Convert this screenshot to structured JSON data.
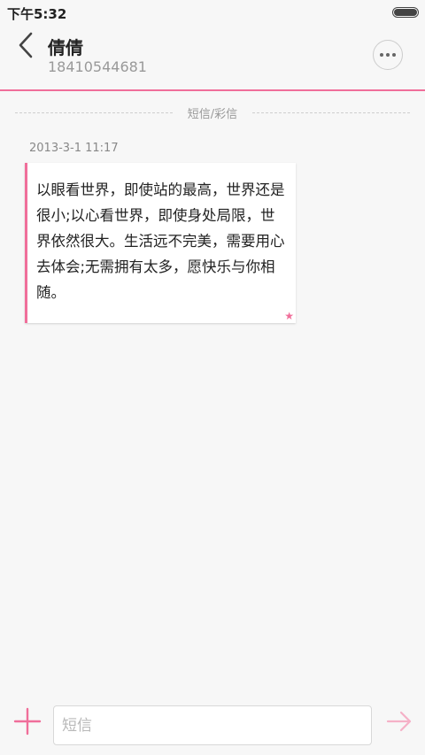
{
  "status_bar": {
    "time": "下午5:32",
    "battery_level": 1.0
  },
  "header": {
    "contact_name": "倩倩",
    "contact_number": "18410544681",
    "back_icon": "chevron-left-icon",
    "more_icon": "more-horizontal-icon"
  },
  "conversation": {
    "type_label": "短信/彩信",
    "messages": [
      {
        "timestamp": "2013-3-1 11:17",
        "text": "以眼看世界，即使站的最高，世界还是很小;以心看世界，即使身处局限，世界依然很大。生活远不完美，需要用心去体会;无需拥有太多，愿快乐与你相随。",
        "starred": true,
        "star_icon": "star-icon"
      }
    ]
  },
  "composer": {
    "placeholder": "短信",
    "value": "",
    "add_icon": "plus-icon",
    "send_icon": "send-arrow-icon"
  },
  "colors": {
    "accent": "#f06e9a",
    "background": "#f7f7f7",
    "send_icon": "#f5b1c7"
  }
}
